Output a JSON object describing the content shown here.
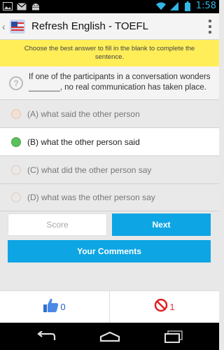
{
  "status_bar": {
    "time": "1:58",
    "icons": [
      "image-icon",
      "email-icon",
      "android-icon",
      "wifi-icon",
      "signal-icon",
      "battery-icon"
    ]
  },
  "action_bar": {
    "title": "Refresh English - TOEFL"
  },
  "instruction": {
    "text": "Choose the best answer to fill in the blank to complete the sentence."
  },
  "question": {
    "text": "If one of the participants in a conversation wonders _______, no real communication has taken place."
  },
  "options": [
    {
      "label": "(A) what said the  other person",
      "state": "faded"
    },
    {
      "label": "(B) what the other person said",
      "state": "selected"
    },
    {
      "label": "(C) what did the  other person say",
      "state": "empty"
    },
    {
      "label": "(D) what was the other person say",
      "state": "empty"
    }
  ],
  "buttons": {
    "score": "Score",
    "next": "Next",
    "comments": "Your Comments"
  },
  "feedback": {
    "likes": "0",
    "dislikes": "1"
  },
  "colors": {
    "accent": "#0ea5e4",
    "banner": "#ffee58",
    "selected_radio": "#5cc05c",
    "time": "#33b5e5"
  }
}
